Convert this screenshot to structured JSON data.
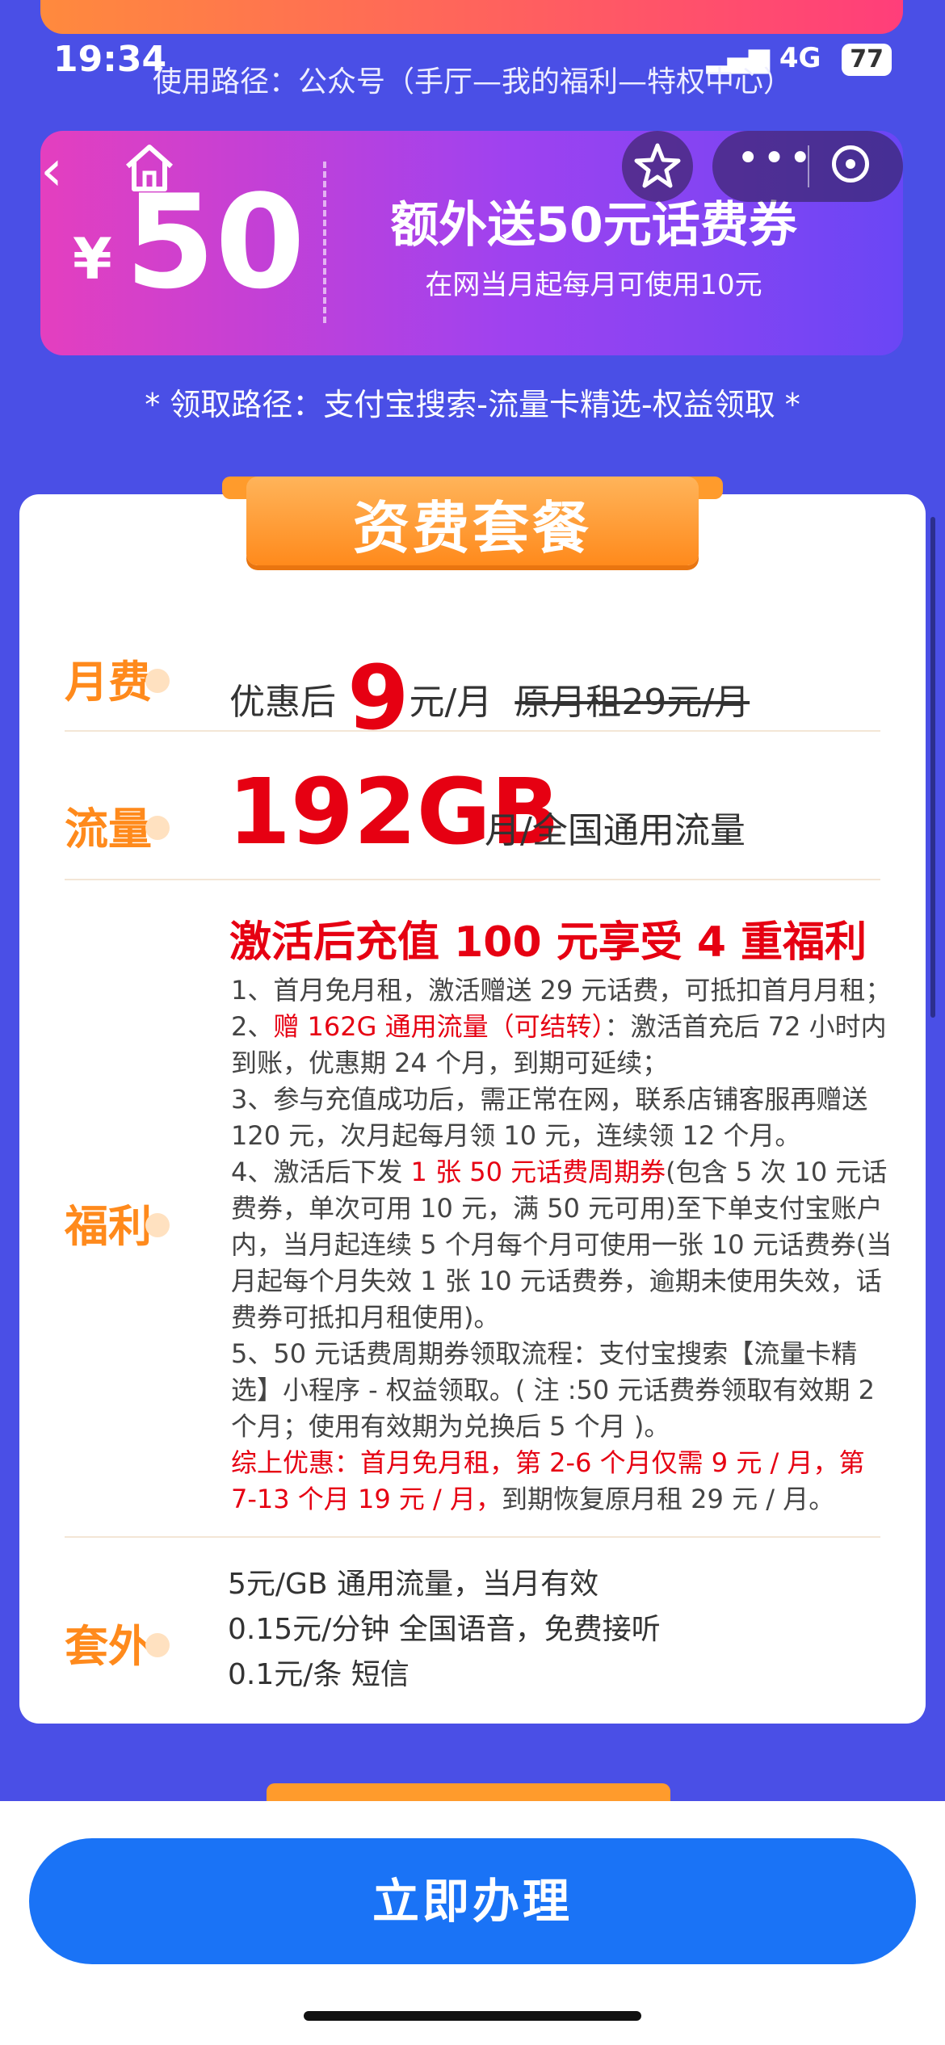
{
  "status": {
    "time": "19:34",
    "network": "4G",
    "battery": "77"
  },
  "route_top": "使用路径：公众号（手厅—我的福利—特权中心）",
  "coupon": {
    "currency": "¥",
    "amount": "50",
    "title": "额外送50元话费券",
    "subtitle": "在网当月起每月可使用10元"
  },
  "route_alipay": "* 领取路径：支付宝搜索-流量卡精选-权益领取 *",
  "section_title": "资费套餐",
  "fee": {
    "label": "月费",
    "prefix": "优惠后",
    "price": "9",
    "unit": "元/月",
    "original": "原月租29元/月"
  },
  "flow": {
    "label": "流量",
    "amount": "192GB",
    "unit": "月/全国通用流量"
  },
  "benefits": {
    "label": "福利",
    "headline": "激活后充值 100 元享受 4 重福利",
    "item1": "1、首月免月租，激活赠送 29 元话费，可抵扣首月月租；",
    "item2_prefix": "2、",
    "item2_red": "赠 162G 通用流量（可结转）",
    "item2_rest": "：激活首充后 72 小时内到账，优惠期 24 个月，到期可延续；",
    "item3": "3、参与充值成功后，需正常在网，联系店铺客服再赠送 120 元，次月起每月领 10 元，连续领 12 个月。",
    "item4_prefix": "4、激活后下发 ",
    "item4_red": "1 张 50 元话费周期券",
    "item4_rest": "(包含 5 次 10 元话费券，单次可用 10 元，满 50 元可用)至下单支付宝账户内，当月起连续 5 个月每个月可使用一张 10 元话费券(当月起每个月失效 1 张 10 元话费券，逾期未使用失效，话费券可抵扣月租使用)。",
    "item5": "5、50 元话费周期券领取流程：支付宝搜索【流量卡精选】小程序 - 权益领取。( 注 :50 元话费券领取有效期 2 个月；使用有效期为兑换后 5 个月 )。",
    "summary_red": "综上优惠：首月免月租，第 2-6 个月仅需 9 元 / 月，第 7-13 个月 19 元 / 月，",
    "summary_rest": "到期恢复原月租 29 元 / 月。"
  },
  "extra": {
    "label": "套外",
    "line1": "5元/GB 通用流量，当月有效",
    "line2": "0.15元/分钟  全国语音，免费接听",
    "line3": "0.1元/条 短信"
  },
  "cta_label": "立即办理"
}
